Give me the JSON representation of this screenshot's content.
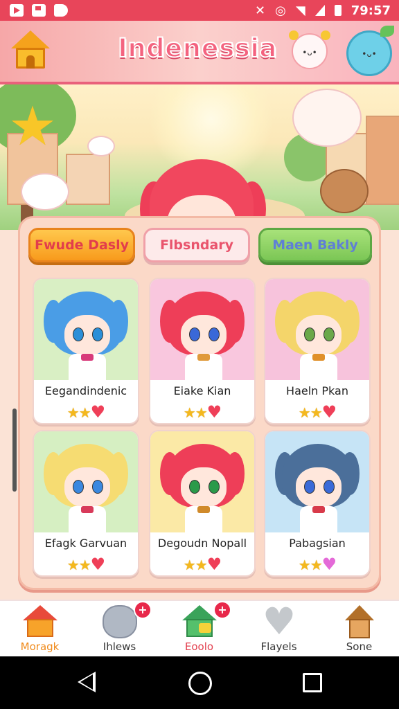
{
  "status_bar": {
    "icons": [
      "play-icon",
      "save-icon",
      "d-icon",
      "close-icon",
      "alarm-icon",
      "wifi-icon",
      "signal-icon",
      "battery-icon"
    ],
    "time": "79:57"
  },
  "header": {
    "title": "Indenessia"
  },
  "tabs": [
    {
      "label": "Fwude Dasly",
      "color": "#f89a1c"
    },
    {
      "label": "Flbsndary",
      "color": "#fdeaea"
    },
    {
      "label": "Maen Bakly",
      "color": "#7bc655"
    }
  ],
  "characters": [
    {
      "name": "Eegandindenic",
      "stars": 2,
      "bg": "#d9efc4",
      "hair": "#4a9de6",
      "eyes": "#2b8fd8",
      "bow": "#d83a7a"
    },
    {
      "name": "Eiake Kian",
      "stars": 2,
      "bg": "#f9c7de",
      "hair": "#ee3e58",
      "eyes": "#3a68d8",
      "bow": "#e09a3a"
    },
    {
      "name": "Haeln Pkan",
      "stars": 2,
      "bg": "#f7c3dc",
      "hair": "#f4d56a",
      "eyes": "#6aa84a",
      "bow": "#e0902a"
    },
    {
      "name": "Efagk Garvuan",
      "stars": 2,
      "bg": "#d6efc2",
      "hair": "#f6dc72",
      "eyes": "#3a88e0",
      "bow": "#d83a5a"
    },
    {
      "name": "Degoudn Nopall",
      "stars": 2,
      "bg": "#fbe9a6",
      "hair": "#ee3e58",
      "eyes": "#2a9a4a",
      "bow": "#d08a2a"
    },
    {
      "name": "Pabagsian",
      "stars": 2,
      "bg": "#c6e4f6",
      "hair": "#4b6f9a",
      "eyes": "#3a6ad8",
      "bow": "#d83a4a"
    }
  ],
  "bottom_nav": [
    {
      "label": "Moragk",
      "icon": "home-icon",
      "badge": "",
      "label_color": "#f08a1a"
    },
    {
      "label": "Ihlews",
      "icon": "cloud-icon",
      "badge": "+",
      "label_color": "#333333"
    },
    {
      "label": "Eoolo",
      "icon": "house-star-icon",
      "badge": "+",
      "label_color": "#e23d4c"
    },
    {
      "label": "Flayels",
      "icon": "heart-icon",
      "badge": "",
      "label_color": "#333333"
    },
    {
      "label": "Sone",
      "icon": "hut-icon",
      "badge": "",
      "label_color": "#333333"
    }
  ],
  "system_nav": [
    "back-icon",
    "home-circle-icon",
    "recents-icon"
  ]
}
